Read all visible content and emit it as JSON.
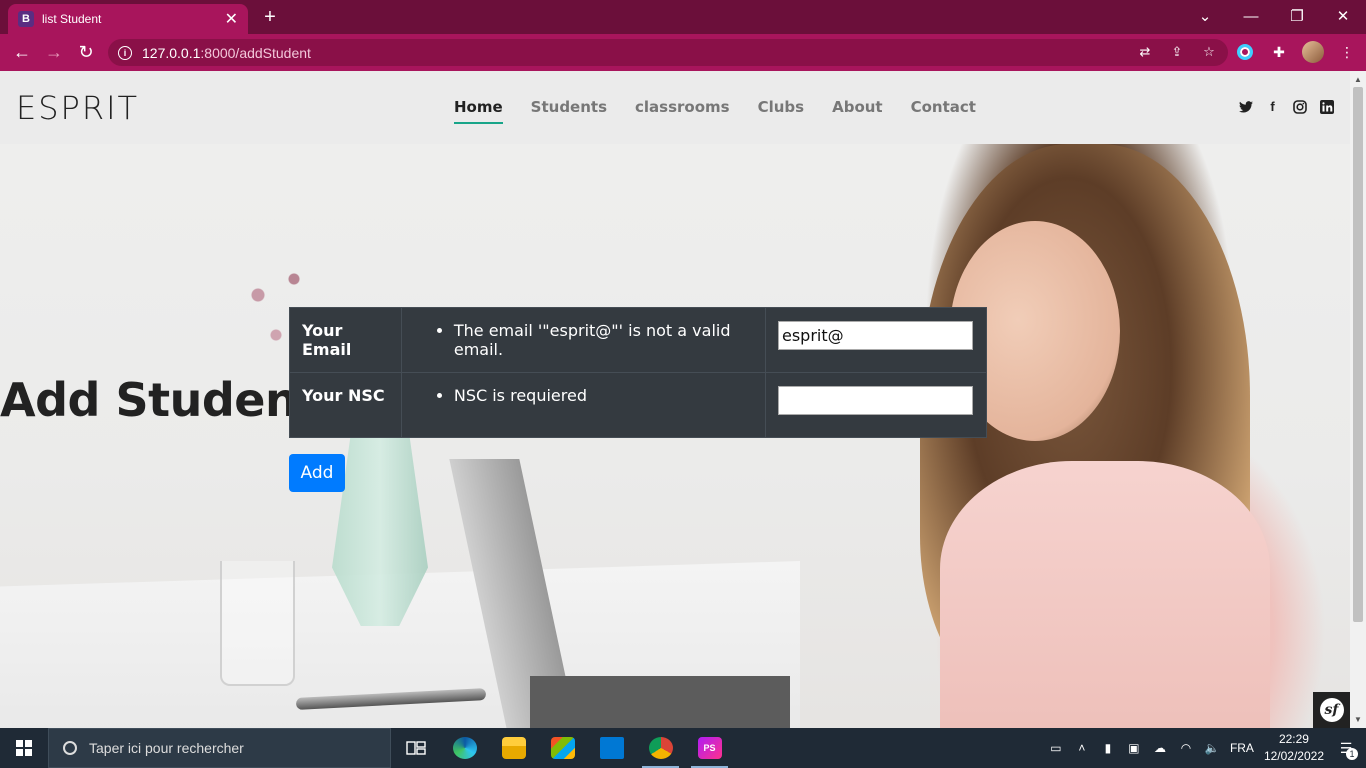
{
  "browser": {
    "tab_title": "list Student",
    "tab_favicon_letter": "B",
    "url_host": "127.0.0.1",
    "url_path": ":8000/addStudent"
  },
  "site": {
    "logo": "ESPRIT",
    "nav": [
      "Home",
      "Students",
      "classrooms",
      "Clubs",
      "About",
      "Contact"
    ],
    "active_nav": "Home",
    "social_icons": [
      "twitter-icon",
      "facebook-icon",
      "instagram-icon",
      "linkedin-icon"
    ]
  },
  "page": {
    "title": "Add Student",
    "form": {
      "rows": [
        {
          "label": "Your Email",
          "error": "The email '\"esprit@\"' is not a valid email.",
          "value": "esprit@"
        },
        {
          "label": "Your NSC",
          "error": "NSC is requiered",
          "value": ""
        }
      ],
      "submit_label": "Add"
    }
  },
  "taskbar": {
    "search_placeholder": "Taper ici pour rechercher",
    "language": "FRA",
    "time": "22:29",
    "date": "12/02/2022",
    "notification_count": "1",
    "apps": [
      "task-view-icon",
      "edge-icon",
      "file-explorer-icon",
      "store-icon",
      "mail-icon",
      "chrome-icon",
      "phpstorm-icon"
    ]
  },
  "colors": {
    "browser_frame": "#6b0f3a",
    "browser_toolbar": "#a8155c",
    "nav_accent": "#18a589",
    "primary_button": "#007bff",
    "form_table_bg": "#343a40"
  }
}
